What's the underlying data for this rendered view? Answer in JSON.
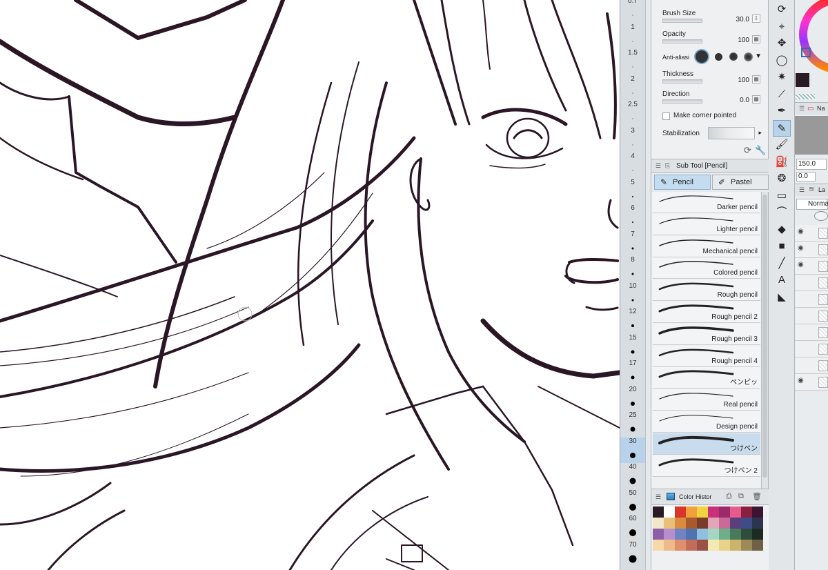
{
  "brush_sizes": [
    {
      "label": "0.7",
      "dot": 0
    },
    {
      "label": "1",
      "dot": 0
    },
    {
      "label": "1.5",
      "dot": 0
    },
    {
      "label": "2",
      "dot": 0
    },
    {
      "label": "2.5",
      "dot": 0
    },
    {
      "label": "3",
      "dot": 0
    },
    {
      "label": "4",
      "dot": 0
    },
    {
      "label": "5",
      "dot": 2
    },
    {
      "label": "6",
      "dot": 2
    },
    {
      "label": "7",
      "dot": 3
    },
    {
      "label": "8",
      "dot": 3
    },
    {
      "label": "10",
      "dot": 3
    },
    {
      "label": "12",
      "dot": 4
    },
    {
      "label": "15",
      "dot": 5
    },
    {
      "label": "17",
      "dot": 5
    },
    {
      "label": "20",
      "dot": 6
    },
    {
      "label": "25",
      "dot": 7
    },
    {
      "label": "30",
      "dot": 8
    },
    {
      "label": "40",
      "dot": 9
    },
    {
      "label": "50",
      "dot": 10
    },
    {
      "label": "60",
      "dot": 10
    },
    {
      "label": "70",
      "dot": 11
    }
  ],
  "selected_size": "30",
  "tool_property": {
    "brush_size": {
      "label": "Brush Size",
      "value": "30.0"
    },
    "opacity": {
      "label": "Opacity",
      "value": "100"
    },
    "anti_alias": {
      "label": "Anti-aliasi"
    },
    "thickness": {
      "label": "Thickness",
      "value": "100"
    },
    "direction": {
      "label": "Direction",
      "value": "0.0"
    },
    "corner": {
      "label": "Make corner pointed"
    },
    "stabilization": {
      "label": "Stabilization"
    }
  },
  "subtool": {
    "header": "Sub Tool [Pencil]",
    "tabs": [
      {
        "label": "Pencil",
        "icon": "pencil-icon"
      },
      {
        "label": "Pastel",
        "icon": "pastel-icon"
      }
    ],
    "brushes": [
      {
        "name": "Darker pencil"
      },
      {
        "name": "Lighter pencil"
      },
      {
        "name": "Mechanical pencil"
      },
      {
        "name": "Colored pencil"
      },
      {
        "name": "Rough pencil"
      },
      {
        "name": "Rough pencil 2"
      },
      {
        "name": "Rough pencil 3"
      },
      {
        "name": "Rough pencil 4"
      },
      {
        "name": "ペンピッ"
      },
      {
        "name": "Real pencil"
      },
      {
        "name": "Design pencil"
      },
      {
        "name": "つけペン"
      },
      {
        "name": "つけペン 2"
      }
    ],
    "selected_brush": "つけペン"
  },
  "color_history": {
    "header": "Color Histor",
    "colors": [
      "#2a1a24",
      "#ffffff",
      "#d9352b",
      "#f0a13c",
      "#f1d23f",
      "#c8317a",
      "#9c2a6b",
      "#e65a8e",
      "#8a1f3f",
      "#3b1432",
      "#f2e7c9",
      "#e8c07a",
      "#d98c3d",
      "#a65b2e",
      "#7b3b2a",
      "#e2a7b6",
      "#c96b96",
      "#5a3f7a",
      "#3e4c8a",
      "#2c3550",
      "#8e5fa6",
      "#b78fcf",
      "#6f84c4",
      "#4f73b0",
      "#8fc0de",
      "#a5d6c4",
      "#6fae8a",
      "#497a5c",
      "#2f4d3c",
      "#1d2a22",
      "#f6d9a6",
      "#f0b98a",
      "#e08f6c",
      "#c26c5a",
      "#9a5248",
      "#f4e9b3",
      "#e9d38a",
      "#cbb36a",
      "#9d8a56",
      "#6f6148"
    ]
  },
  "tools": [
    {
      "name": "rotate-view-icon",
      "glyph": "⟳"
    },
    {
      "name": "operation-icon",
      "glyph": "⌖"
    },
    {
      "name": "move-layer-icon",
      "glyph": "✥"
    },
    {
      "name": "lasso-icon",
      "glyph": "◯"
    },
    {
      "name": "magic-wand-icon",
      "glyph": "✷"
    },
    {
      "name": "eyedropper-icon",
      "glyph": "⟋"
    },
    {
      "name": "pen-icon",
      "glyph": "✒"
    },
    {
      "name": "pencil-icon",
      "glyph": "✎"
    },
    {
      "name": "brush-icon",
      "glyph": "🖌"
    },
    {
      "name": "airbrush-icon",
      "glyph": "⛽"
    },
    {
      "name": "decoration-icon",
      "glyph": "❂"
    },
    {
      "name": "eraser-icon",
      "glyph": "▭"
    },
    {
      "name": "blend-icon",
      "glyph": "⌒"
    },
    {
      "name": "fill-icon",
      "glyph": "◆"
    },
    {
      "name": "gradient-icon",
      "glyph": "■"
    },
    {
      "name": "figure-icon",
      "glyph": "╱"
    },
    {
      "name": "text-icon",
      "glyph": "A"
    },
    {
      "name": "balloon-icon",
      "glyph": "◣"
    }
  ],
  "active_tool": "pencil-icon",
  "right_panel": {
    "zoom_value": "150.0",
    "angle_value": "0.0",
    "blend_mode": "Norma",
    "nav_label": "Na",
    "layer_label": "La"
  },
  "colors": {
    "ink": "#2b1625",
    "main_color": "#2a1a24",
    "accent": "#b8d2ea",
    "panel_bg": "#eef0f2"
  }
}
